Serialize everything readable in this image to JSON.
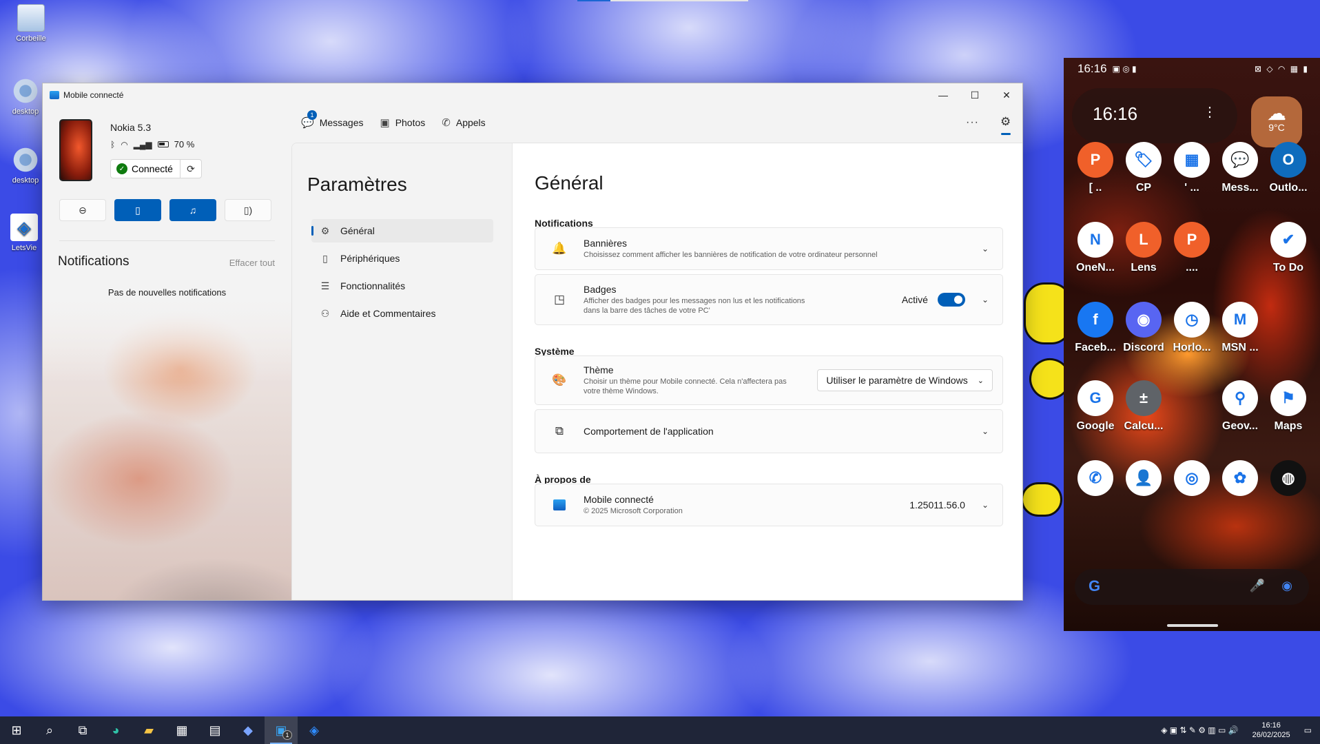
{
  "desktop": {
    "icons": [
      {
        "label": "Corbeille",
        "icon": "recycle-bin-icon"
      },
      {
        "label": "desktop",
        "icon": "settings-shortcut-icon"
      },
      {
        "label": "desktop",
        "icon": "settings-shortcut-icon"
      },
      {
        "label": "LetsVie",
        "icon": "letsview-icon"
      }
    ]
  },
  "window": {
    "title": "Mobile connecté",
    "controls": {
      "minimize": "—",
      "maximize": "☐",
      "close": "✕"
    }
  },
  "device": {
    "name": "Nokia 5.3",
    "battery": "70 %",
    "connected_label": "Connecté"
  },
  "notifications": {
    "title": "Notifications",
    "clear_all": "Effacer tout",
    "empty": "Pas de nouvelles notifications"
  },
  "tabs": [
    {
      "label": "Messages",
      "badge": "1"
    },
    {
      "label": "Photos"
    },
    {
      "label": "Appels"
    }
  ],
  "settings_nav": {
    "title": "Paramètres",
    "items": [
      {
        "label": "Général",
        "active": true
      },
      {
        "label": "Périphériques"
      },
      {
        "label": "Fonctionnalités"
      },
      {
        "label": "Aide et Commentaires"
      }
    ]
  },
  "main": {
    "title": "Général",
    "sections": {
      "notifications": "Notifications",
      "system": "Système",
      "about": "À propos de"
    },
    "banners": {
      "title": "Bannières",
      "desc": "Choisissez comment afficher les bannières de notification de votre ordinateur personnel"
    },
    "badges": {
      "title": "Badges",
      "desc": "Afficher des badges pour les messages non lus et les notifications dans la barre des tâches de votre PC'",
      "toggle_label": "Activé",
      "enabled": true
    },
    "theme": {
      "title": "Thème",
      "desc": "Choisir un thème pour Mobile connecté. Cela n'affectera pas votre thème Windows.",
      "selected": "Utiliser le paramètre de Windows"
    },
    "app_behavior": {
      "title": "Comportement de l'application"
    },
    "about_app": {
      "title": "Mobile connecté",
      "copyright": "© 2025 Microsoft Corporation",
      "version": "1.25011.56.0"
    }
  },
  "phone": {
    "status_time": "16:16",
    "widget_time": "16:16",
    "weather": "9°C",
    "apps": [
      {
        "label": "[ ..",
        "letter": "P",
        "color": "#f0602a"
      },
      {
        "label": "CP",
        "letter": "🏷",
        "color": "#ffffff"
      },
      {
        "label": "' ...",
        "letter": "▦",
        "color": "#ffffff"
      },
      {
        "label": "Mess...",
        "letter": "💬",
        "color": "#ffffff"
      },
      {
        "label": "Outlo...",
        "letter": "O",
        "color": "#0f6cbd"
      },
      {
        "label": "OneN...",
        "letter": "N",
        "color": "#ffffff"
      },
      {
        "label": "Lens",
        "letter": "L",
        "color": "#f0602a"
      },
      {
        "label": "....",
        "letter": "P",
        "color": "#f0602a"
      },
      {
        "label": "To Do",
        "letter": "✔",
        "color": "#ffffff"
      },
      {
        "label": "Faceb...",
        "letter": "f",
        "color": "#1877f2"
      },
      {
        "label": "Discord",
        "letter": "◉",
        "color": "#5865f2"
      },
      {
        "label": "Horlo...",
        "letter": "◷",
        "color": "#ffffff"
      },
      {
        "label": "MSN ...",
        "letter": "M",
        "color": "#ffffff"
      },
      {
        "label": "Google",
        "letter": "G",
        "color": "#ffffff"
      },
      {
        "label": "Calcu...",
        "letter": "±",
        "color": "#5f6368"
      },
      {
        "label": "Geov...",
        "letter": "⚲",
        "color": "#ffffff"
      },
      {
        "label": "Maps",
        "letter": "⚑",
        "color": "#ffffff"
      },
      {
        "label": "",
        "letter": "✆",
        "color": "#ffffff"
      },
      {
        "label": "",
        "letter": "👤",
        "color": "#ffffff"
      },
      {
        "label": "",
        "letter": "◎",
        "color": "#ffffff"
      },
      {
        "label": "",
        "letter": "✿",
        "color": "#ffffff"
      },
      {
        "label": "",
        "letter": "◍",
        "color": "#111111"
      }
    ]
  },
  "taskbar": {
    "clock_time": "16:16",
    "clock_date": "26/02/2025",
    "badge": "1"
  }
}
